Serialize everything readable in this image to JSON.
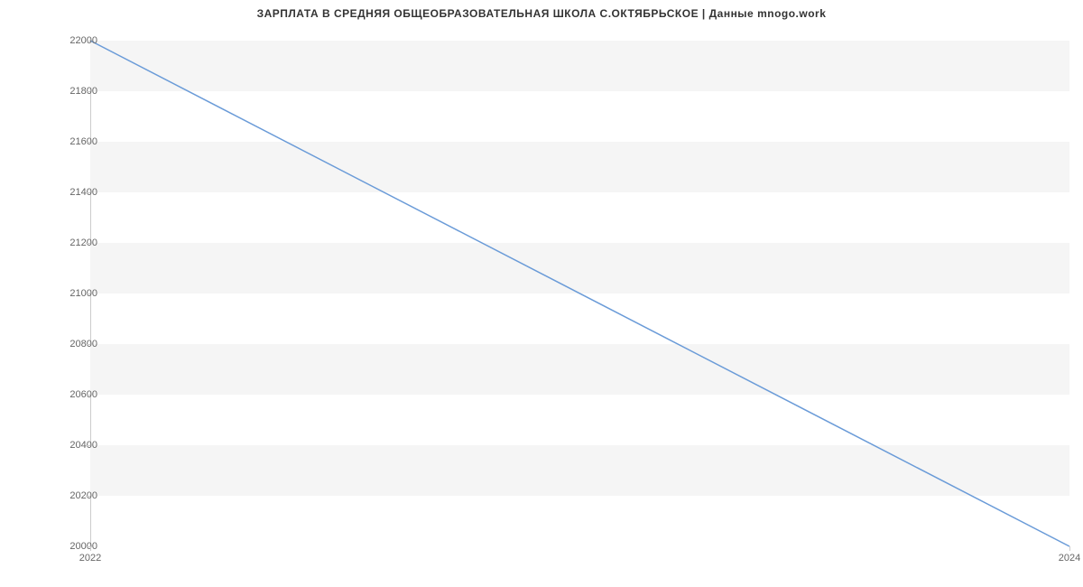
{
  "chart_data": {
    "type": "line",
    "title": "ЗАРПЛАТА В СРЕДНЯЯ ОБЩЕОБРАЗОВАТЕЛЬНАЯ ШКОЛА С.ОКТЯБРЬСКОЕ | Данные mnogo.work",
    "x": [
      2022,
      2024
    ],
    "values": [
      22000,
      20000
    ],
    "xlabel": "",
    "ylabel": "",
    "xlim": [
      2022,
      2024
    ],
    "ylim": [
      20000,
      22000
    ],
    "y_ticks": [
      20000,
      20200,
      20400,
      20600,
      20800,
      21000,
      21200,
      21400,
      21600,
      21800,
      22000
    ],
    "x_ticks": [
      2022,
      2024
    ],
    "line_color": "#6a9bd8",
    "band_color": "#f5f5f5"
  }
}
